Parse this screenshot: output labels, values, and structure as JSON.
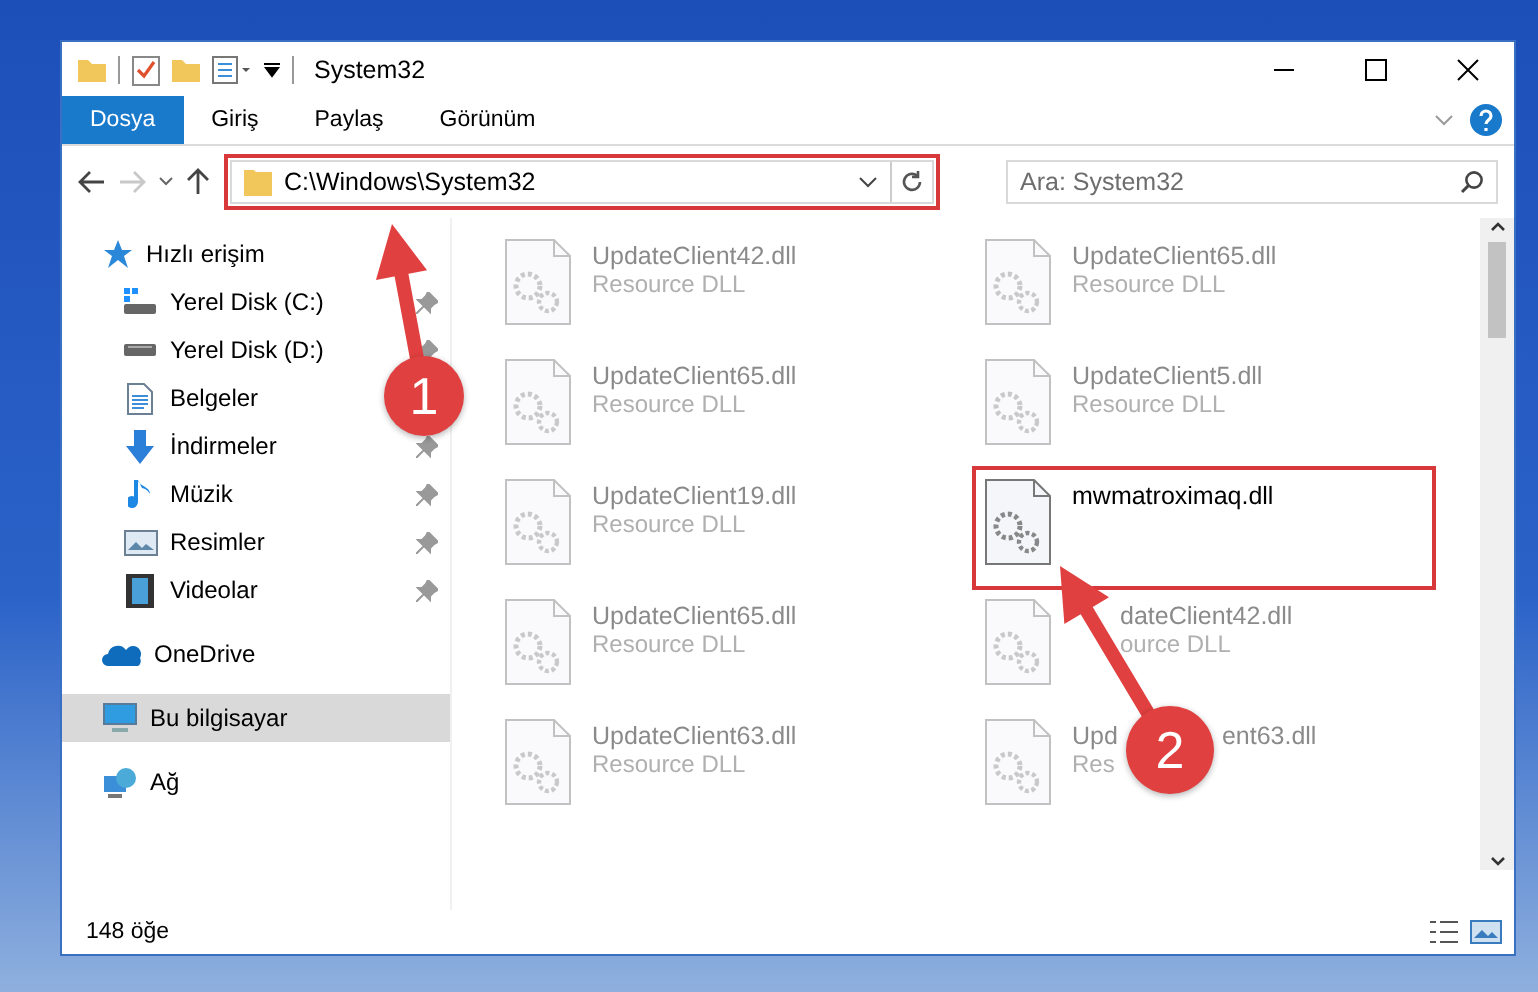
{
  "window": {
    "title": "System32"
  },
  "ribbon": {
    "tabs": [
      {
        "label": "Dosya",
        "selected": true
      },
      {
        "label": "Giriş",
        "selected": false
      },
      {
        "label": "Paylaş",
        "selected": false
      },
      {
        "label": "Görünüm",
        "selected": false
      }
    ]
  },
  "address_bar": {
    "path": "C:\\Windows\\System32",
    "highlighted": true
  },
  "search": {
    "placeholder": "Ara: System32"
  },
  "sidebar": {
    "items": [
      {
        "label": "Hızlı erişim",
        "selected": false,
        "children": [
          {
            "label": "Yerel Disk (C:)",
            "pinned": true,
            "selected": false
          },
          {
            "label": "Yerel Disk (D:)",
            "pinned": true,
            "selected": false
          },
          {
            "label": "Belgeler",
            "selected": false
          },
          {
            "label": "İndirmeler",
            "pinned": true,
            "selected": false
          },
          {
            "label": "Müzik",
            "pinned": true,
            "selected": false
          },
          {
            "label": "Resimler",
            "pinned": true,
            "selected": false
          },
          {
            "label": "Videolar",
            "pinned": true,
            "selected": false
          }
        ]
      },
      {
        "label": "OneDrive",
        "selected": false
      },
      {
        "label": "Bu bilgisayar",
        "selected": true
      },
      {
        "label": "Ağ",
        "selected": false
      }
    ]
  },
  "files": [
    {
      "kind": "plain",
      "name": "UpdateClient42.dll",
      "type": "Resource DLL",
      "faded": true,
      "highlighted": false
    },
    {
      "kind": "plain",
      "name": "UpdateClient65.dll",
      "type": "Resource DLL",
      "faded": true,
      "highlighted": false
    },
    {
      "kind": "plain",
      "name": "UpdateClient65.dll",
      "type": "Resource DLL",
      "faded": true,
      "highlighted": false
    },
    {
      "kind": "plain",
      "name": "UpdateClient5.dll",
      "type": "Resource DLL",
      "faded": true,
      "highlighted": false
    },
    {
      "kind": "plain",
      "name": "UpdateClient19.dll",
      "type": "Resource DLL",
      "faded": true,
      "highlighted": false
    },
    {
      "kind": "plain",
      "name": "mwmatroximaq.dll",
      "faded": false,
      "highlighted": true
    },
    {
      "kind": "plain",
      "name": "UpdateClient65.dll",
      "type": "Resource DLL",
      "faded": true,
      "highlighted": false
    },
    {
      "kind": "cut",
      "name": "dateClient42.dll",
      "type": "ource DLL",
      "faded": true,
      "highlighted": false
    },
    {
      "kind": "plain",
      "name": "UpdateClient63.dll",
      "type": "Resource DLL",
      "faded": true,
      "highlighted": false
    },
    {
      "kind": "split",
      "name": "Upd",
      "name_end": "ent63.dll",
      "type": "Res",
      "faded": true,
      "highlighted": false
    }
  ],
  "status_bar": {
    "item_count": "148 öğe"
  },
  "annotations": [
    {
      "label": "1"
    },
    {
      "label": "2"
    }
  ]
}
